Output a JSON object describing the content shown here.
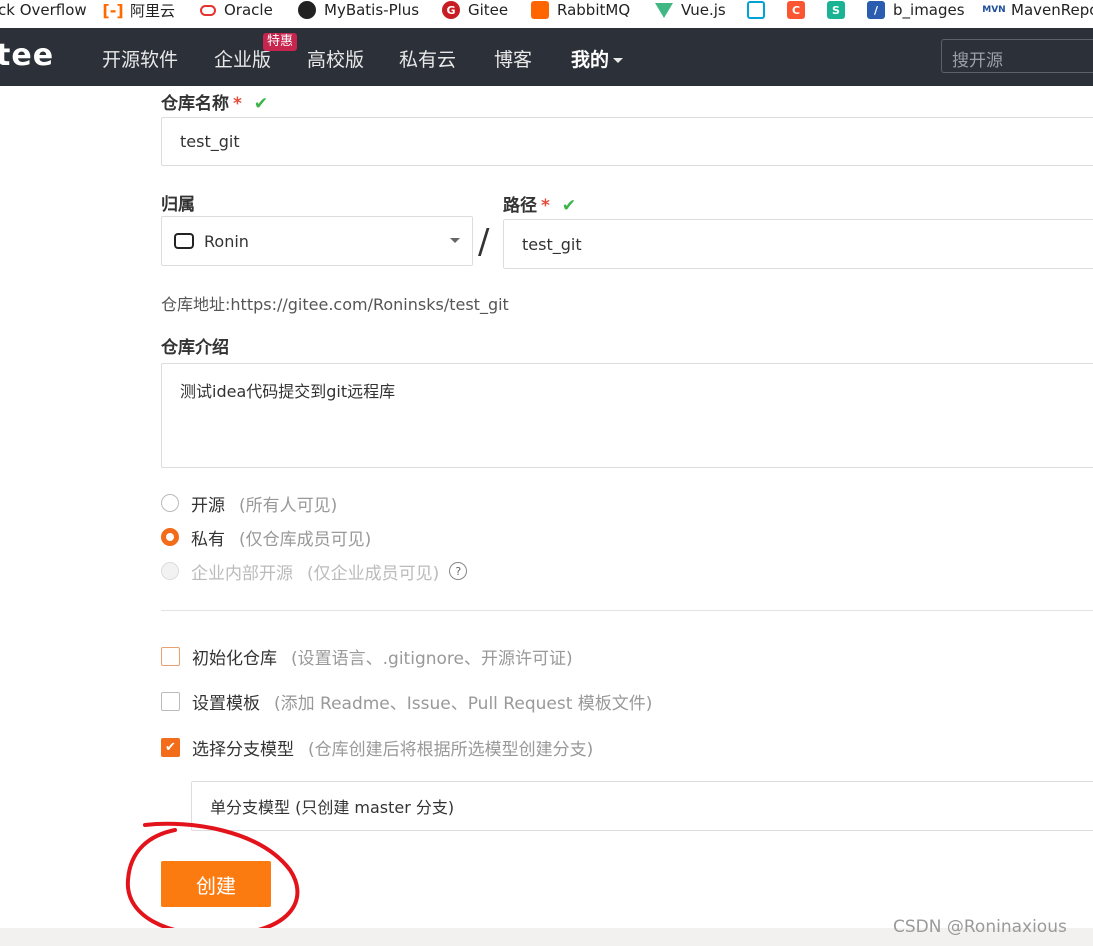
{
  "bookmarks": [
    {
      "label": "ck Overflow",
      "icon": "stackoverflow-icon",
      "color": ""
    },
    {
      "label": "阿里云",
      "icon": "aliyun-icon",
      "color": "#ff6a00"
    },
    {
      "label": "Oracle",
      "icon": "oracle-icon",
      "color": "#e5322d"
    },
    {
      "label": "MyBatis-Plus",
      "icon": "mybatis-icon",
      "color": "#222222"
    },
    {
      "label": "Gitee",
      "icon": "gitee-icon",
      "color": "#c71d23"
    },
    {
      "label": "RabbitMQ",
      "icon": "rabbitmq-icon",
      "color": "#ff6600"
    },
    {
      "label": "Vue.js",
      "icon": "vue-icon",
      "color": "#41b883"
    },
    {
      "label": "",
      "icon": "bilibili-icon",
      "color": "#00a1d6"
    },
    {
      "label": "",
      "icon": "csdn-icon",
      "color": "#fc5531"
    },
    {
      "label": "",
      "icon": "s-icon",
      "color": "#1ab394"
    },
    {
      "label": "b_images",
      "icon": "b-images-icon",
      "color": "#2a5db0"
    },
    {
      "label": "MavenRepo",
      "icon": "maven-icon",
      "color": "#1f4e9b"
    }
  ],
  "navbar": {
    "logo": "tee",
    "items": [
      "开源软件",
      "企业版",
      "高校版",
      "私有云",
      "博客",
      "我的"
    ],
    "badge": "特惠",
    "search_placeholder": "搜开源"
  },
  "form": {
    "repo_name_label": "仓库名称",
    "required_mark": "*",
    "check_mark": "✔",
    "repo_name_value": "test_git",
    "owner_label": "归属",
    "owner_value": "Ronin",
    "path_label": "路径",
    "path_separator": "/",
    "path_value": "test_git",
    "address_label": "仓库地址:",
    "address_value": "https://gitee.com/Roninsks/test_git",
    "intro_label": "仓库介绍",
    "intro_value": "测试idea代码提交到git远程库",
    "visibility": [
      {
        "label": "开源",
        "hint": "(所有人可见)",
        "state": "unchecked"
      },
      {
        "label": "私有",
        "hint": "(仅仓库成员可见)",
        "state": "checked"
      },
      {
        "label": "企业内部开源",
        "hint": "(仅企业成员可见)",
        "state": "disabled"
      }
    ],
    "help_glyph": "?",
    "options": [
      {
        "label": "初始化仓库",
        "hint": "(设置语言、.gitignore、开源许可证)",
        "checked": false
      },
      {
        "label": "设置模板",
        "hint": "(添加 Readme、Issue、Pull Request 模板文件)",
        "checked": false
      },
      {
        "label": "选择分支模型",
        "hint": "(仓库创建后将根据所选模型创建分支)",
        "checked": true
      }
    ],
    "checkbox_glyph": "✔",
    "branch_model_value": "单分支模型 (只创建 master 分支)",
    "create_button": "创建"
  },
  "watermark": "CSDN @Roninaxious",
  "colors": {
    "navbar_bg": "#2c3038",
    "accent_orange": "#fc7b10",
    "check_green": "#3bb54a",
    "annotation_red": "#e3131b"
  }
}
